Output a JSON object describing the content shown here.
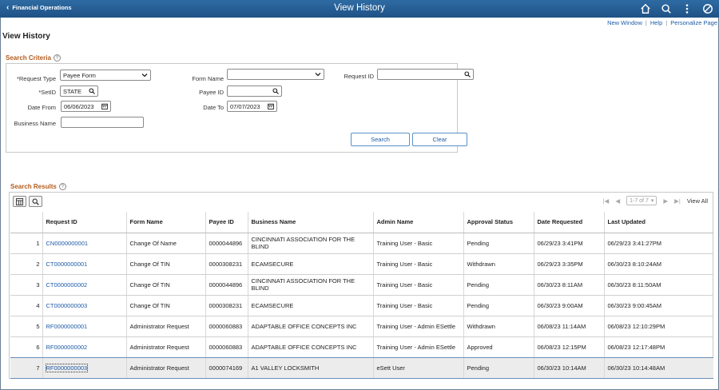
{
  "header": {
    "back_label": "Financial Operations",
    "title": "View History"
  },
  "util_links": {
    "new_window": "New Window",
    "help": "Help",
    "personalize": "Personalize Page"
  },
  "page_title": "View History",
  "search_criteria": {
    "label": "Search Criteria",
    "request_type": {
      "label": "*Request Type",
      "value": "Payee Form"
    },
    "form_name": {
      "label": "Form Name",
      "value": ""
    },
    "request_id": {
      "label": "Request ID",
      "value": ""
    },
    "setid": {
      "label": "*SetID",
      "value": "STATE"
    },
    "payee_id": {
      "label": "Payee ID",
      "value": ""
    },
    "date_from": {
      "label": "Date From",
      "value": "06/06/2023"
    },
    "date_to": {
      "label": "Date To",
      "value": "07/07/2023"
    },
    "business_name": {
      "label": "Business Name",
      "value": ""
    },
    "search_button": "Search",
    "clear_button": "Clear"
  },
  "search_results": {
    "label": "Search Results",
    "pager": {
      "range": "1-7 of 7",
      "view_all": "View All"
    },
    "columns": [
      "",
      "Request ID",
      "Form Name",
      "Payee ID",
      "Business Name",
      "Admin Name",
      "Approval Status",
      "Date Requested",
      "Last Updated"
    ],
    "rows": [
      {
        "num": "1",
        "request_id": "CN0000000001",
        "form_name": "Change Of Name",
        "payee_id": "0000044896",
        "business_name": "CINCINNATI ASSOCIATION FOR THE BLIND",
        "admin_name": "Training User - Basic",
        "status": "Pending",
        "requested": "06/29/23  3:41PM",
        "updated": "06/29/23  3:41:27PM"
      },
      {
        "num": "2",
        "request_id": "CT0000000001",
        "form_name": "Change Of TIN",
        "payee_id": "0000308231",
        "business_name": "ECAMSECURE",
        "admin_name": "Training User - Basic",
        "status": "Withdrawn",
        "requested": "06/29/23  3:35PM",
        "updated": "06/30/23  8:10:24AM"
      },
      {
        "num": "3",
        "request_id": "CT0000000002",
        "form_name": "Change Of TIN",
        "payee_id": "0000044896",
        "business_name": "CINCINNATI ASSOCIATION FOR THE BLIND",
        "admin_name": "Training User - Basic",
        "status": "Pending",
        "requested": "06/30/23  8:11AM",
        "updated": "06/30/23  8:11:50AM"
      },
      {
        "num": "4",
        "request_id": "CT0000000003",
        "form_name": "Change Of TIN",
        "payee_id": "0000308231",
        "business_name": "ECAMSECURE",
        "admin_name": "Training User - Basic",
        "status": "Pending",
        "requested": "06/30/23  9:00AM",
        "updated": "06/30/23  9:00:45AM"
      },
      {
        "num": "5",
        "request_id": "RF0000000001",
        "form_name": "Administrator Request",
        "payee_id": "0000060883",
        "business_name": "ADAPTABLE OFFICE CONCEPTS INC",
        "admin_name": "Training User - Admin ESettle",
        "status": "Withdrawn",
        "requested": "06/08/23 11:14AM",
        "updated": "06/08/23 12:10:29PM"
      },
      {
        "num": "6",
        "request_id": "RF0000000002",
        "form_name": "Administrator Request",
        "payee_id": "0000060883",
        "business_name": "ADAPTABLE OFFICE CONCEPTS INC",
        "admin_name": "Training User - Admin ESettle",
        "status": "Approved",
        "requested": "06/08/23 12:15PM",
        "updated": "06/08/23 12:17:48PM"
      },
      {
        "num": "7",
        "request_id": "RF0000000003",
        "form_name": "Administrator Request",
        "payee_id": "0000074169",
        "business_name": "A1 VALLEY LOCKSMITH",
        "admin_name": "eSett User",
        "status": "Pending",
        "requested": "06/30/23 10:14AM",
        "updated": "06/30/23 10:14:48AM"
      }
    ]
  },
  "colors": {
    "header_bg": "#1f5286",
    "link": "#1e5ba8",
    "section_label": "#b35c1e"
  }
}
